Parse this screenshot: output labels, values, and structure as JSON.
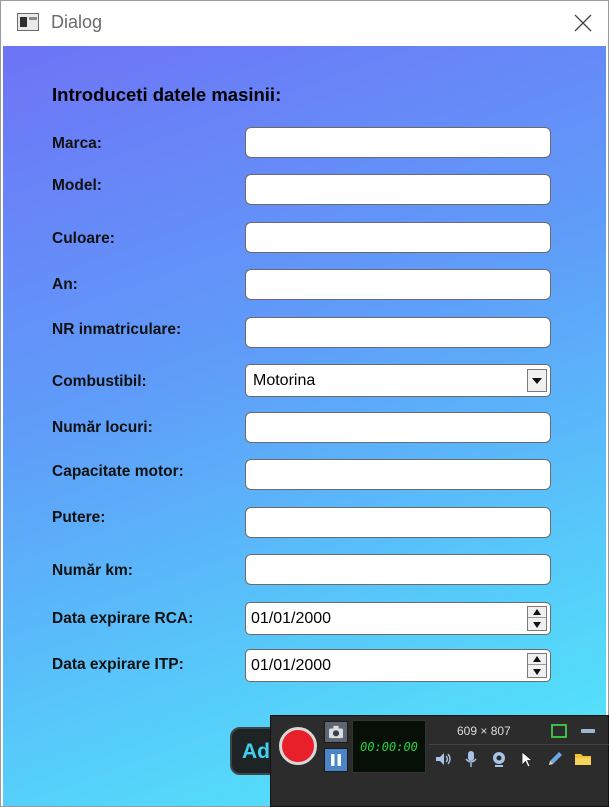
{
  "window": {
    "title": "Dialog"
  },
  "form": {
    "heading": "Introduceti datele masinii:",
    "fields": [
      {
        "label": "Marca:",
        "value": ""
      },
      {
        "label": "Model:",
        "value": ""
      },
      {
        "label": "Culoare:",
        "value": ""
      },
      {
        "label": "An:",
        "value": ""
      },
      {
        "label": "NR inmatriculare:",
        "value": ""
      }
    ],
    "fuel": {
      "label": "Combustibil:",
      "selected": "Motorina"
    },
    "fields2": [
      {
        "label": "Număr locuri:",
        "value": ""
      },
      {
        "label": "Capacitate motor:",
        "value": ""
      },
      {
        "label": "Putere:",
        "value": ""
      },
      {
        "label": "Număr km:",
        "value": ""
      }
    ],
    "rca": {
      "label": "Data expirare RCA:",
      "value": "01/01/2000"
    },
    "itp": {
      "label": "Data expirare ITP:",
      "value": "01/01/2000"
    },
    "add_button": "Ad"
  },
  "recorder": {
    "timer": "00:00:00",
    "size": "609 × 807"
  },
  "colors": {
    "gradient_start": "#6e74f6",
    "gradient_end": "#52ebfa",
    "record": "#e8202a",
    "timer_green": "#27d43f",
    "button_text": "#3fd1ee"
  }
}
